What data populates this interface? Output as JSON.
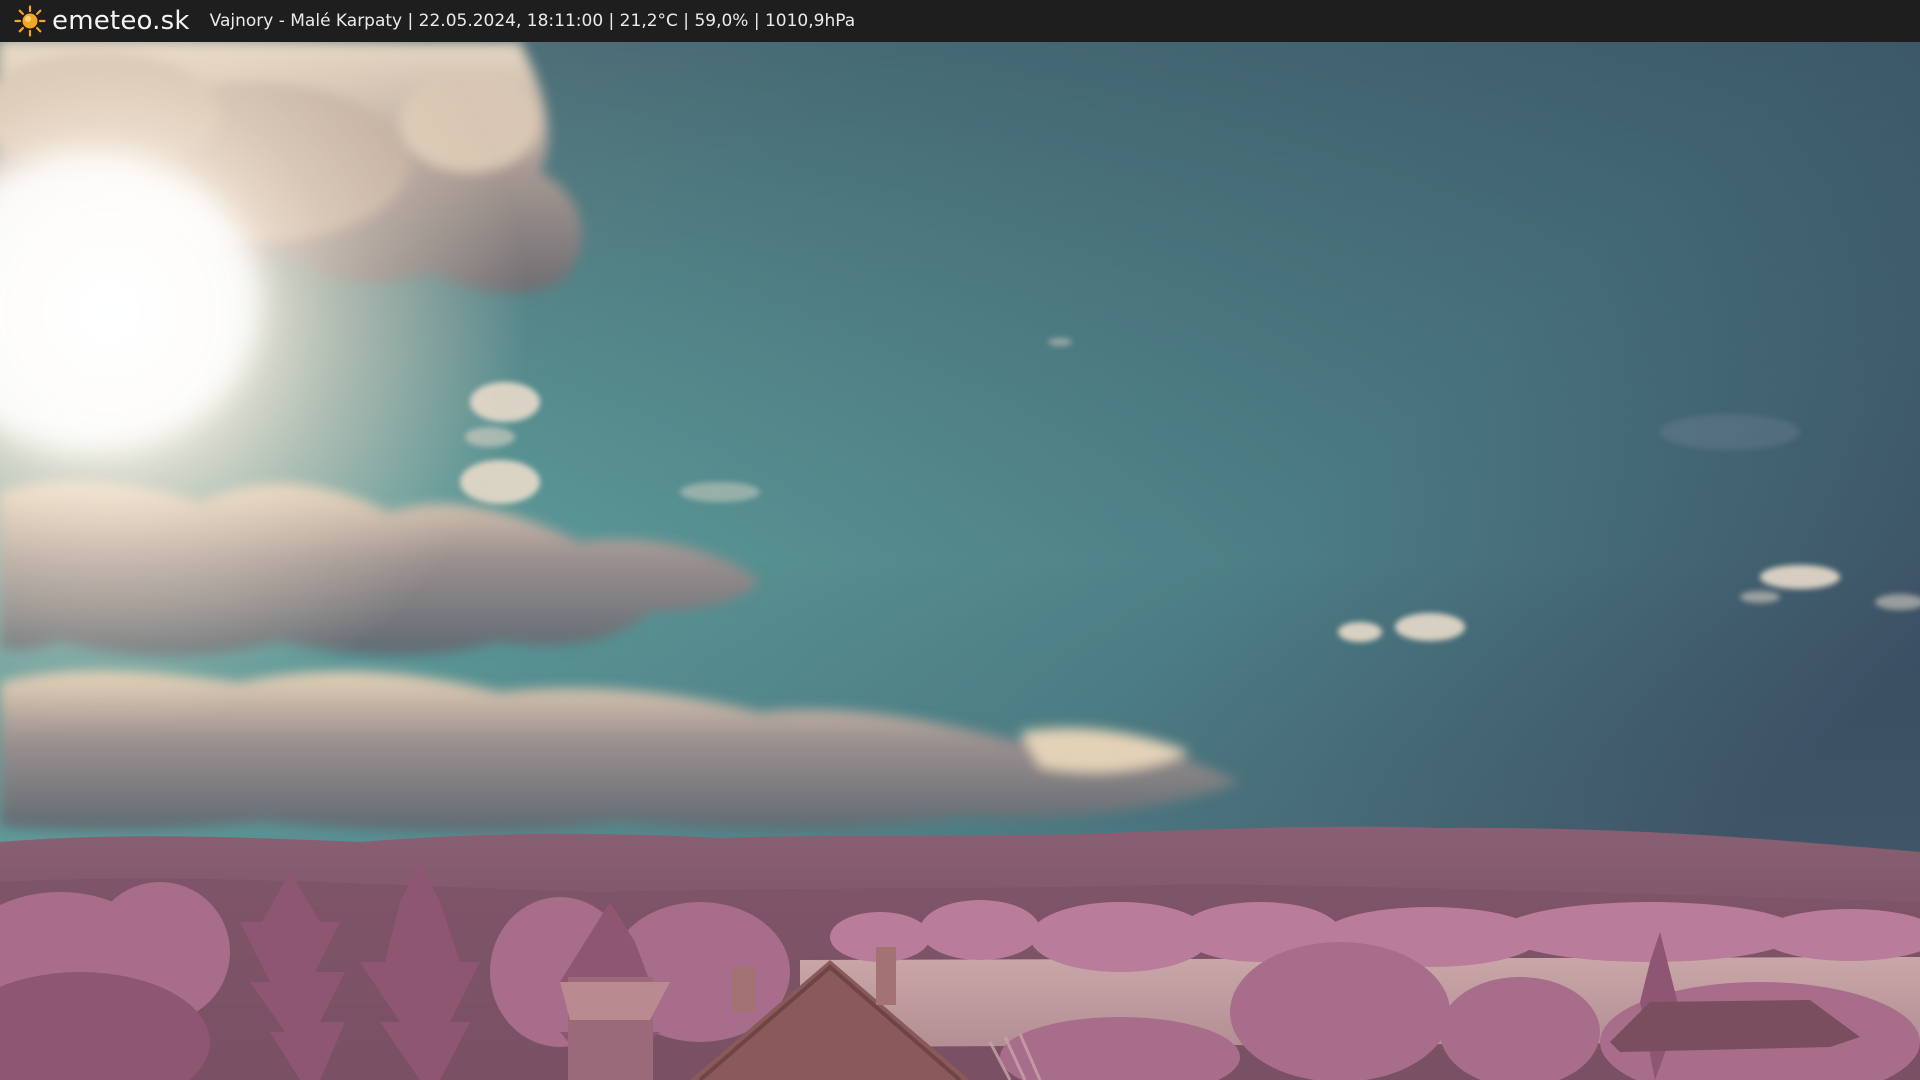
{
  "header": {
    "brand": "emeteo.sk",
    "caption": "Vajnory - Malé Karpaty | 22.05.2024, 18:11:00 | 21,2°C | 59,0% | 1010,9hPa",
    "logo_icon": "sun-icon"
  },
  "colors": {
    "bar_background": "#1e1e1e",
    "sun_icon": "#f5a623",
    "sky_top": "#3b4f63",
    "sky_mid": "#5f9e9c",
    "foliage": "#b97c9a",
    "hills": "#6e4a5a"
  }
}
